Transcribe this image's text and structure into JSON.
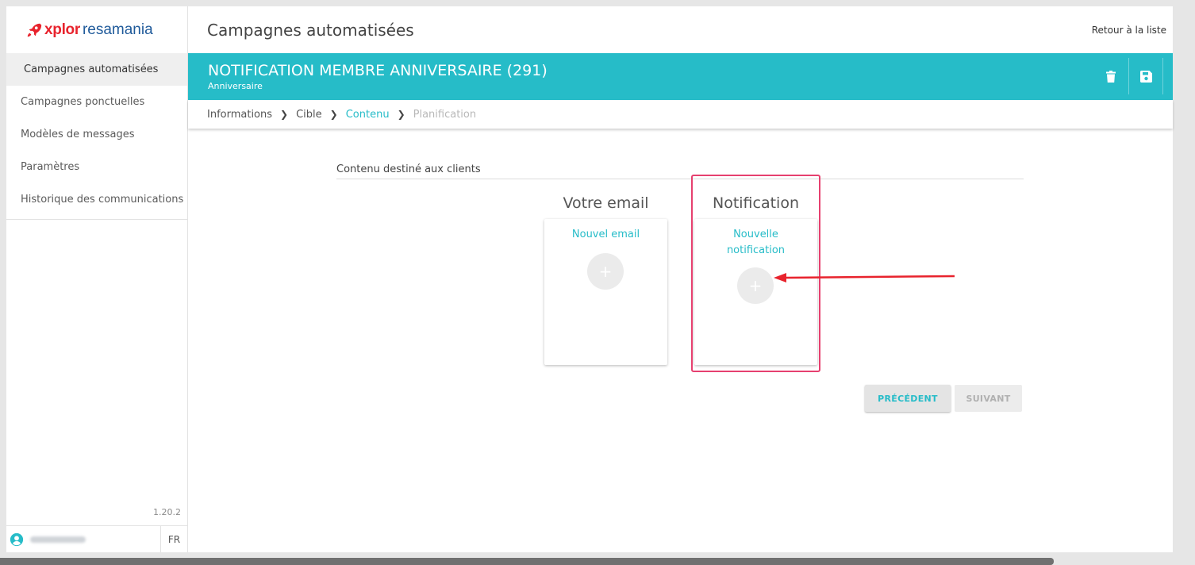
{
  "brand": {
    "part1": "xplor",
    "part2": "resamania",
    "accent": "#e8232d",
    "secondary": "#1f5a9a"
  },
  "sidebar": {
    "items": [
      {
        "label": "Campagnes automatisées"
      },
      {
        "label": "Campagnes ponctuelles"
      },
      {
        "label": "Modèles de messages"
      },
      {
        "label": "Paramètres"
      },
      {
        "label": "Historique des communications"
      }
    ],
    "version": "1.20.2",
    "lang": "FR"
  },
  "header": {
    "title": "Campagnes automatisées",
    "back_link": "Retour à la liste"
  },
  "banner": {
    "title": "NOTIFICATION MEMBRE ANNIVERSAIRE (291)",
    "subtitle": "Anniversaire",
    "color": "#26bcc8",
    "actions": [
      "trash-icon",
      "save-icon"
    ]
  },
  "breadcrumb": {
    "steps": [
      {
        "label": "Informations",
        "state": "done"
      },
      {
        "label": "Cible",
        "state": "done"
      },
      {
        "label": "Contenu",
        "state": "current"
      },
      {
        "label": "Planification",
        "state": "todo"
      }
    ]
  },
  "content": {
    "section_title": "Contenu destiné aux clients",
    "email": {
      "column_title": "Votre email",
      "link": "Nouvel email"
    },
    "notification": {
      "column_title": "Notification",
      "link_line1": "Nouvelle",
      "link_line2": "notification"
    },
    "annotation_color": "#e6406f"
  },
  "buttons": {
    "prev": "PRÉCÉDENT",
    "next": "SUIVANT"
  }
}
